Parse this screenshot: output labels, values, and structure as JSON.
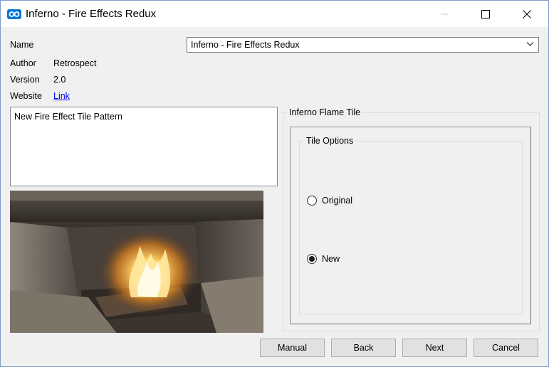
{
  "window": {
    "title": "Inferno - Fire Effects Redux",
    "accent_color": "#0078d7"
  },
  "info": {
    "name_label": "Name",
    "name_value": "Inferno - Fire Effects Redux",
    "author_label": "Author",
    "author_value": "Retrospect",
    "version_label": "Version",
    "version_value": "2.0",
    "website_label": "Website",
    "website_link": "Link"
  },
  "description": "New Fire Effect Tile Pattern",
  "group": {
    "title": "Inferno Flame Tile",
    "options_title": "Tile Options",
    "options": [
      {
        "label": "Original",
        "selected": false
      },
      {
        "label": "New",
        "selected": true
      }
    ]
  },
  "buttons": {
    "manual": "Manual",
    "back": "Back",
    "next": "Next",
    "cancel": "Cancel"
  }
}
